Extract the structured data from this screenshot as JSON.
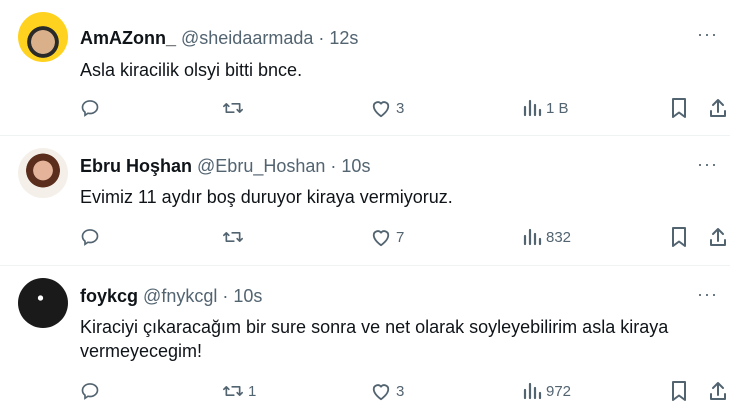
{
  "tweets": [
    {
      "name": "AmAZonn_",
      "handle": "@sheidaarmada",
      "separator": "·",
      "time": "12s",
      "text": "Asla kiracilik olsyi bitti bnce.",
      "reply_count": "",
      "retweet_count": "",
      "like_count": "3",
      "view_count": "1 B",
      "more_label": "···"
    },
    {
      "name": "Ebru Hoşhan",
      "handle": "@Ebru_Hoshan",
      "separator": "·",
      "time": "10s",
      "text": "Evimiz 11 aydır boş duruyor kiraya vermiyoruz.",
      "reply_count": "",
      "retweet_count": "",
      "like_count": "7",
      "view_count": "832",
      "more_label": "···"
    },
    {
      "name": "foykcg",
      "handle": "@fnykcgl",
      "separator": "·",
      "time": "10s",
      "text": "Kiraciyi çıkaracağım bir sure sonra ve net olarak soyleyebilirim asla kiraya vermeyecegim!",
      "reply_count": "",
      "retweet_count": "1",
      "like_count": "3",
      "view_count": "972",
      "more_label": "···"
    }
  ],
  "icons": {
    "reply": "reply-icon",
    "retweet": "retweet-icon",
    "like": "heart-icon",
    "views": "views-icon",
    "bookmark": "bookmark-icon",
    "share": "share-icon",
    "more": "more-icon"
  },
  "colors": {
    "text": "#0f1419",
    "muted": "#536471",
    "divider": "#eff3f4"
  }
}
